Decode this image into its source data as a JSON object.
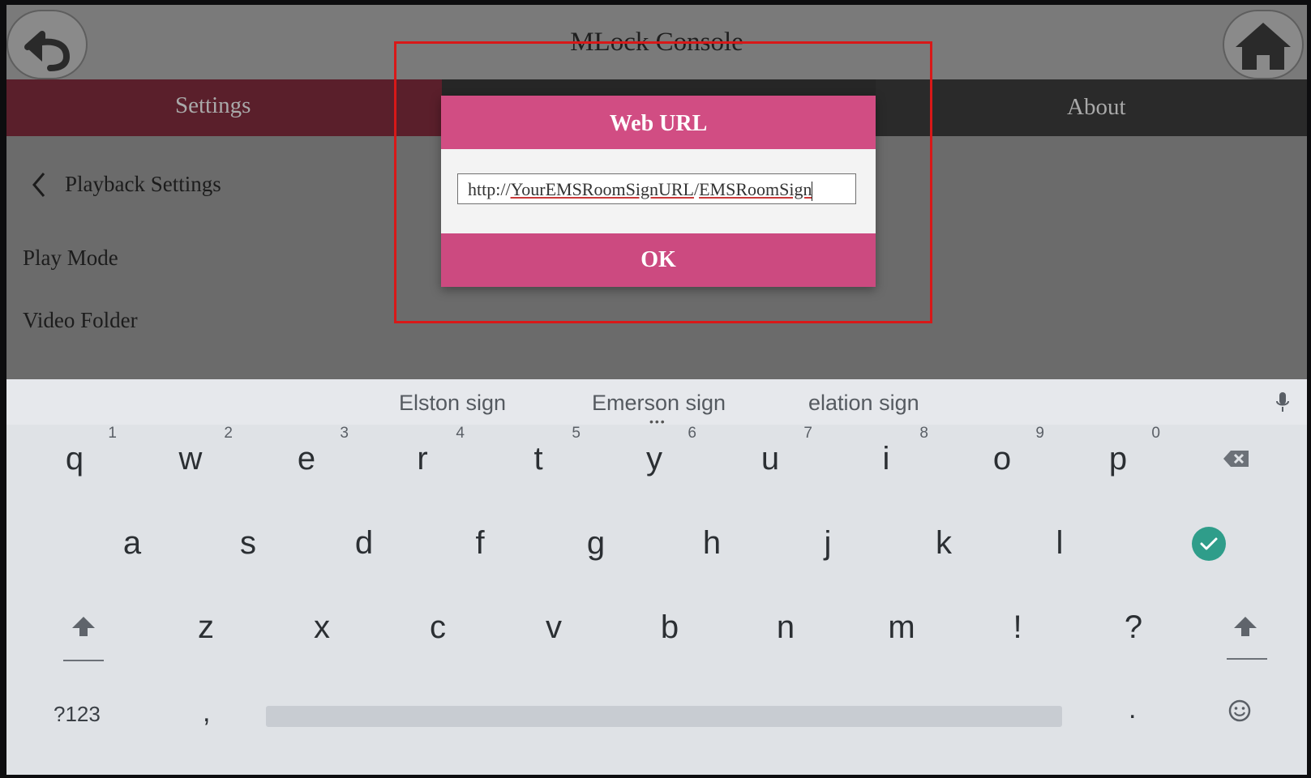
{
  "app": {
    "title": "MLock Console"
  },
  "tabs": {
    "settings": "Settings",
    "about": "About"
  },
  "settings": {
    "breadcrumb": "Playback Settings",
    "rows": [
      "Play Mode",
      "Video Folder"
    ]
  },
  "dialog": {
    "title": "Web URL",
    "url_prefix": "http://",
    "url_host": "YourEMSRoomSignURL",
    "url_sep": "/",
    "url_path": "EMSRoomSign",
    "ok_label": "OK"
  },
  "keyboard": {
    "suggestions": [
      "Elston sign",
      "Emerson sign",
      "elation sign"
    ],
    "row1": [
      {
        "key": "q",
        "hint": "1"
      },
      {
        "key": "w",
        "hint": "2"
      },
      {
        "key": "e",
        "hint": "3"
      },
      {
        "key": "r",
        "hint": "4"
      },
      {
        "key": "t",
        "hint": "5"
      },
      {
        "key": "y",
        "hint": "6"
      },
      {
        "key": "u",
        "hint": "7"
      },
      {
        "key": "i",
        "hint": "8"
      },
      {
        "key": "o",
        "hint": "9"
      },
      {
        "key": "p",
        "hint": "0"
      }
    ],
    "row2": [
      "a",
      "s",
      "d",
      "f",
      "g",
      "h",
      "j",
      "k",
      "l"
    ],
    "row3": [
      "z",
      "x",
      "c",
      "v",
      "b",
      "n",
      "m",
      "!",
      "?"
    ],
    "symbols_label": "?123",
    "comma": ",",
    "period": "."
  },
  "colors": {
    "accent_pink": "#d14d83",
    "highlight_red": "#d81818",
    "settings_tab": "#5a1f2b",
    "enter_teal": "#2f9d8a"
  },
  "icons": [
    "back-icon",
    "home-icon",
    "chevron-left-icon",
    "mic-icon",
    "backspace-icon",
    "check-icon",
    "shift-icon",
    "emoji-icon"
  ]
}
